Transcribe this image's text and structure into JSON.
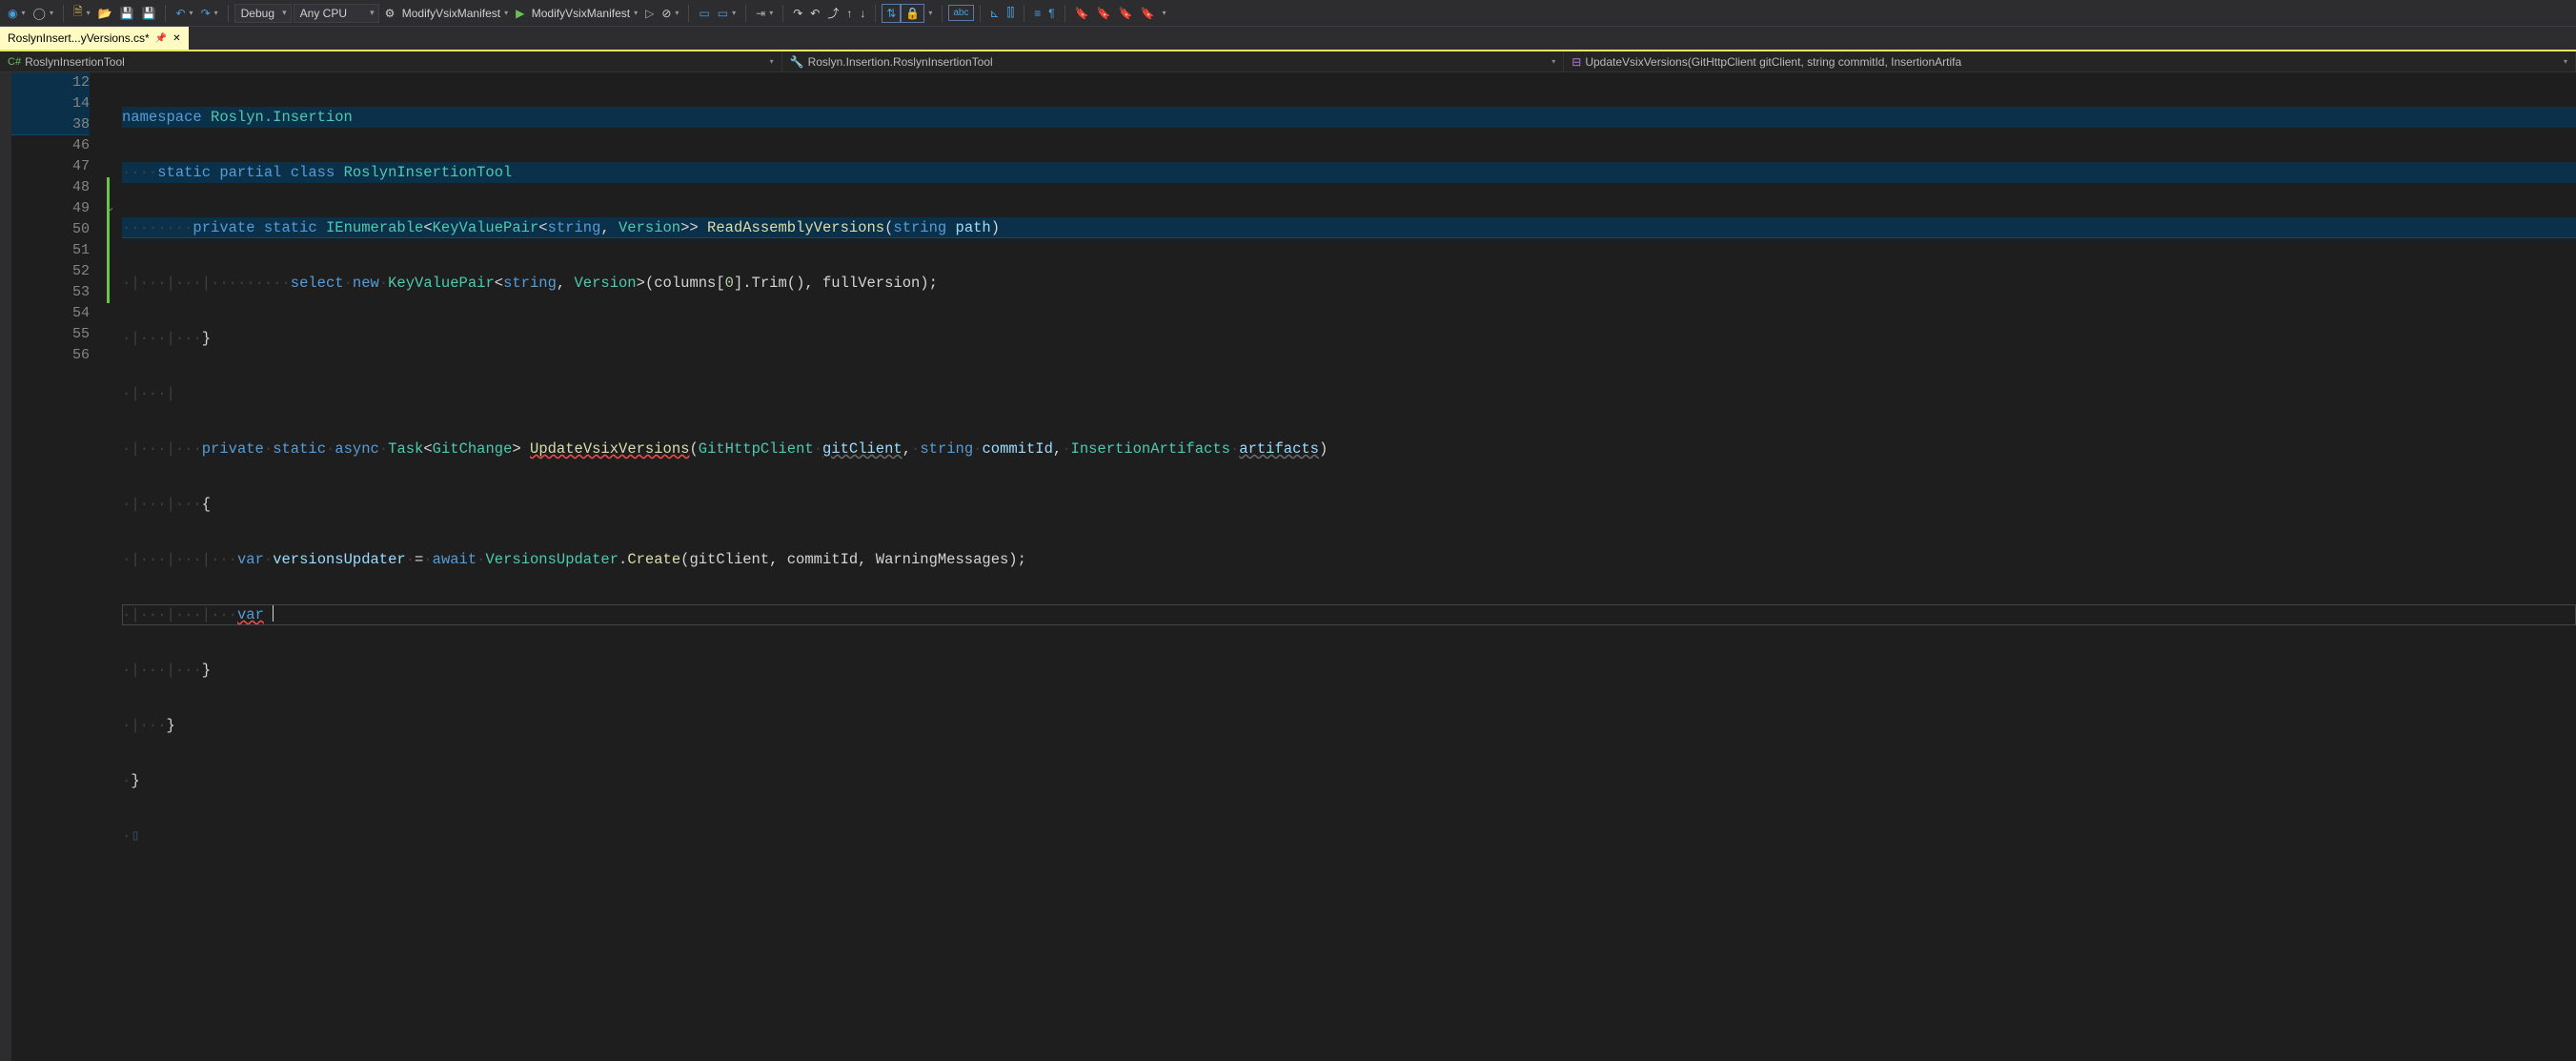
{
  "toolbar": {
    "config_debug": "Debug",
    "platform": "Any CPU",
    "startup1": "ModifyVsixManifest",
    "startup2": "ModifyVsixManifest"
  },
  "tab": {
    "title": "RoslynInsert...yVersions.cs*"
  },
  "nav": {
    "scope": "RoslynInsertionTool",
    "type": "Roslyn.Insertion.RoslynInsertionTool",
    "member": "UpdateVsixVersions(GitHttpClient gitClient, string commitId, InsertionArtifa"
  },
  "gutter": [
    "12",
    "14",
    "38",
    "46",
    "47",
    "48",
    "49",
    "50",
    "51",
    "52",
    "53",
    "54",
    "55",
    "56"
  ],
  "code": {
    "l1": {
      "ns": "namespace",
      "name": "Roslyn.Insertion"
    },
    "l2": {
      "mods": "static partial class",
      "name": "RoslynInsertionTool"
    },
    "l3": {
      "priv": "private",
      "stat": "static",
      "ret": "IEnumerable",
      "kvp": "KeyValuePair",
      "str": "string",
      "ver": "Version",
      "name": "ReadAssemblyVersions",
      "ptype": "string",
      "pname": "path"
    },
    "l4": {
      "sel": "select",
      "new": "new",
      "kvp": "KeyValuePair",
      "str": "string",
      "ver": "Version",
      "rest": "(columns[",
      "idx": "0",
      "rest2": "].Trim(), fullVersion);"
    },
    "l7": {
      "priv": "private",
      "stat": "static",
      "async": "async",
      "task": "Task",
      "gc": "GitChange",
      "name": "UpdateVsixVersions",
      "p1t": "GitHttpClient",
      "p1n": "gitClient",
      "p2t": "string",
      "p2n": "commitId",
      "p3t": "InsertionArtifacts",
      "p3n": "artifacts"
    },
    "l9": {
      "var": "var",
      "name": "versionsUpdater",
      "await": "await",
      "vu": "VersionsUpdater",
      "create": "Create",
      "args": "(gitClient, commitId, WarningMessages);"
    },
    "l10": {
      "var": "var"
    }
  }
}
